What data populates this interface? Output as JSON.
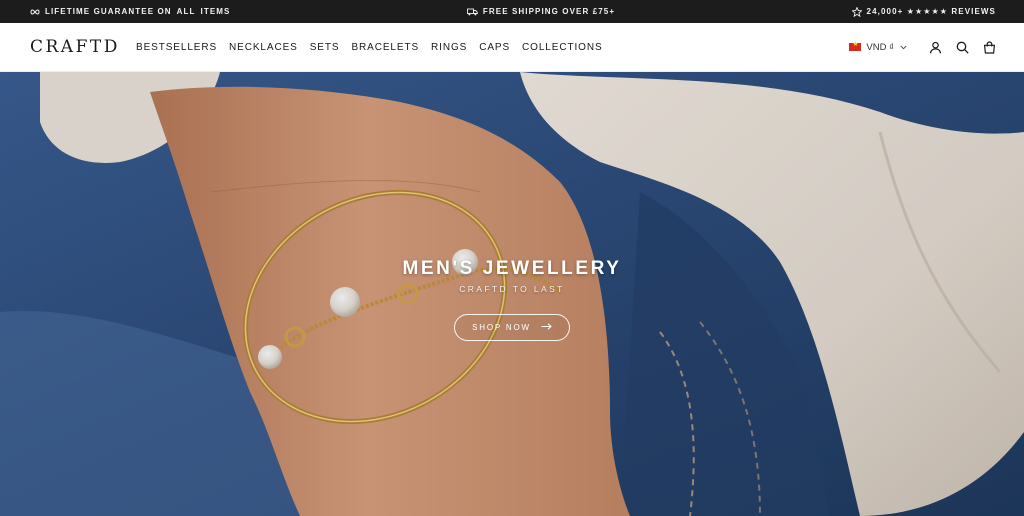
{
  "announcement": {
    "lifetime_prefix": "LIFETIME GUARANTEE ON ",
    "lifetime_bold": "ALL",
    "lifetime_suffix": " ITEMS",
    "shipping": "FREE SHIPPING OVER £75+",
    "reviews": "24,000+ ★★★★★ REVIEWS",
    "icons": [
      "infinity-icon",
      "truck-icon",
      "star-badge-icon"
    ]
  },
  "header": {
    "logo": "CRAFTD",
    "nav": [
      "BESTSELLERS",
      "NECKLACES",
      "SETS",
      "BRACELETS",
      "RINGS",
      "CAPS",
      "COLLECTIONS"
    ],
    "currency": "VND ₫",
    "icons": [
      "flag-vn-icon",
      "chevron-down-icon",
      "account-icon",
      "search-icon",
      "cart-icon"
    ]
  },
  "hero": {
    "title": "MEN'S JEWELLERY",
    "subtitle": "CRAFTD TO LAST",
    "button": "SHOP NOW",
    "button_icon": "arrow-right-icon"
  },
  "colors": {
    "announcement_bg": "#1c1c1c",
    "header_bg": "#ffffff",
    "text": "#1a1a1a",
    "hero_denim": "#2d4a72"
  }
}
